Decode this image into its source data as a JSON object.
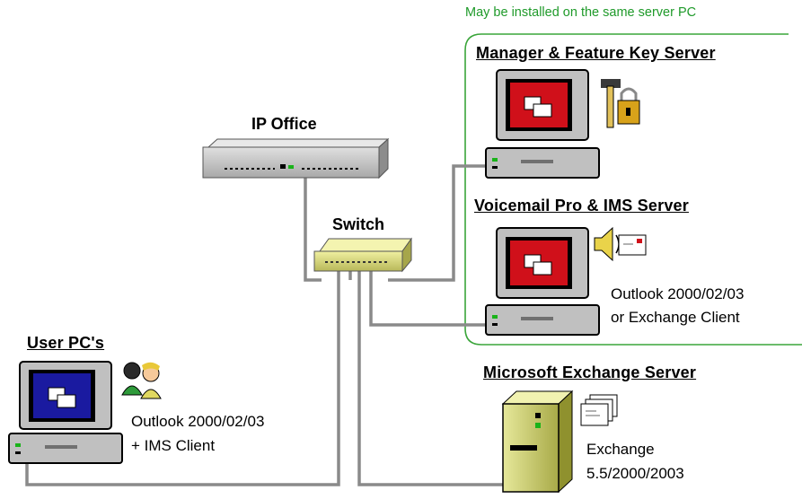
{
  "group_note": "May be installed on the same server PC",
  "ip_office": {
    "label": "IP Office"
  },
  "switch": {
    "label": "Switch"
  },
  "manager_server": {
    "title": "Manager & Feature Key Server"
  },
  "voicemail_server": {
    "title": "Voicemail Pro & IMS Server",
    "note_line1": "Outlook 2000/02/03",
    "note_line2": "or Exchange Client"
  },
  "user_pcs": {
    "title": "User PC's",
    "note_line1": "Outlook 2000/02/03",
    "note_line2": "+ IMS Client"
  },
  "exchange_server": {
    "title": "Microsoft Exchange Server",
    "note_line1": "Exchange",
    "note_line2": "5.5/2000/2003"
  },
  "colors": {
    "group_border": "#3aa53a",
    "cable": "#8a8a8a",
    "pc_body": "#c0c0c0",
    "screen_red": "#d0101a",
    "screen_blue": "#1a1aa0",
    "server_body": "#d6d97a"
  }
}
